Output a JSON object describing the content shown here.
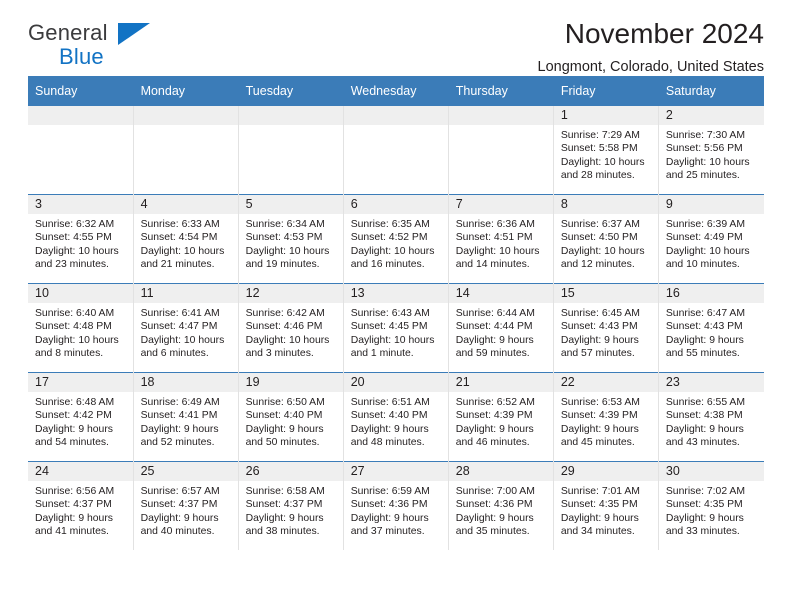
{
  "brand": {
    "name_top": "General",
    "name_bottom": "Blue",
    "triangle_icon": "brand-triangle-icon",
    "colors": {
      "text": "#3b3b3d",
      "accent": "#1273c4"
    }
  },
  "header": {
    "title": "November 2024",
    "location": "Longmont, Colorado, United States"
  },
  "calendar": {
    "header_color": "#3b7cb8",
    "daynum_band_color": "#efefef",
    "weekday_headers": [
      "Sunday",
      "Monday",
      "Tuesday",
      "Wednesday",
      "Thursday",
      "Friday",
      "Saturday"
    ],
    "weeks": [
      [
        {
          "day": ""
        },
        {
          "day": ""
        },
        {
          "day": ""
        },
        {
          "day": ""
        },
        {
          "day": ""
        },
        {
          "day": "1",
          "sunrise": "Sunrise: 7:29 AM",
          "sunset": "Sunset: 5:58 PM",
          "daylight": "Daylight: 10 hours and 28 minutes."
        },
        {
          "day": "2",
          "sunrise": "Sunrise: 7:30 AM",
          "sunset": "Sunset: 5:56 PM",
          "daylight": "Daylight: 10 hours and 25 minutes."
        }
      ],
      [
        {
          "day": "3",
          "sunrise": "Sunrise: 6:32 AM",
          "sunset": "Sunset: 4:55 PM",
          "daylight": "Daylight: 10 hours and 23 minutes."
        },
        {
          "day": "4",
          "sunrise": "Sunrise: 6:33 AM",
          "sunset": "Sunset: 4:54 PM",
          "daylight": "Daylight: 10 hours and 21 minutes."
        },
        {
          "day": "5",
          "sunrise": "Sunrise: 6:34 AM",
          "sunset": "Sunset: 4:53 PM",
          "daylight": "Daylight: 10 hours and 19 minutes."
        },
        {
          "day": "6",
          "sunrise": "Sunrise: 6:35 AM",
          "sunset": "Sunset: 4:52 PM",
          "daylight": "Daylight: 10 hours and 16 minutes."
        },
        {
          "day": "7",
          "sunrise": "Sunrise: 6:36 AM",
          "sunset": "Sunset: 4:51 PM",
          "daylight": "Daylight: 10 hours and 14 minutes."
        },
        {
          "day": "8",
          "sunrise": "Sunrise: 6:37 AM",
          "sunset": "Sunset: 4:50 PM",
          "daylight": "Daylight: 10 hours and 12 minutes."
        },
        {
          "day": "9",
          "sunrise": "Sunrise: 6:39 AM",
          "sunset": "Sunset: 4:49 PM",
          "daylight": "Daylight: 10 hours and 10 minutes."
        }
      ],
      [
        {
          "day": "10",
          "sunrise": "Sunrise: 6:40 AM",
          "sunset": "Sunset: 4:48 PM",
          "daylight": "Daylight: 10 hours and 8 minutes."
        },
        {
          "day": "11",
          "sunrise": "Sunrise: 6:41 AM",
          "sunset": "Sunset: 4:47 PM",
          "daylight": "Daylight: 10 hours and 6 minutes."
        },
        {
          "day": "12",
          "sunrise": "Sunrise: 6:42 AM",
          "sunset": "Sunset: 4:46 PM",
          "daylight": "Daylight: 10 hours and 3 minutes."
        },
        {
          "day": "13",
          "sunrise": "Sunrise: 6:43 AM",
          "sunset": "Sunset: 4:45 PM",
          "daylight": "Daylight: 10 hours and 1 minute."
        },
        {
          "day": "14",
          "sunrise": "Sunrise: 6:44 AM",
          "sunset": "Sunset: 4:44 PM",
          "daylight": "Daylight: 9 hours and 59 minutes."
        },
        {
          "day": "15",
          "sunrise": "Sunrise: 6:45 AM",
          "sunset": "Sunset: 4:43 PM",
          "daylight": "Daylight: 9 hours and 57 minutes."
        },
        {
          "day": "16",
          "sunrise": "Sunrise: 6:47 AM",
          "sunset": "Sunset: 4:43 PM",
          "daylight": "Daylight: 9 hours and 55 minutes."
        }
      ],
      [
        {
          "day": "17",
          "sunrise": "Sunrise: 6:48 AM",
          "sunset": "Sunset: 4:42 PM",
          "daylight": "Daylight: 9 hours and 54 minutes."
        },
        {
          "day": "18",
          "sunrise": "Sunrise: 6:49 AM",
          "sunset": "Sunset: 4:41 PM",
          "daylight": "Daylight: 9 hours and 52 minutes."
        },
        {
          "day": "19",
          "sunrise": "Sunrise: 6:50 AM",
          "sunset": "Sunset: 4:40 PM",
          "daylight": "Daylight: 9 hours and 50 minutes."
        },
        {
          "day": "20",
          "sunrise": "Sunrise: 6:51 AM",
          "sunset": "Sunset: 4:40 PM",
          "daylight": "Daylight: 9 hours and 48 minutes."
        },
        {
          "day": "21",
          "sunrise": "Sunrise: 6:52 AM",
          "sunset": "Sunset: 4:39 PM",
          "daylight": "Daylight: 9 hours and 46 minutes."
        },
        {
          "day": "22",
          "sunrise": "Sunrise: 6:53 AM",
          "sunset": "Sunset: 4:39 PM",
          "daylight": "Daylight: 9 hours and 45 minutes."
        },
        {
          "day": "23",
          "sunrise": "Sunrise: 6:55 AM",
          "sunset": "Sunset: 4:38 PM",
          "daylight": "Daylight: 9 hours and 43 minutes."
        }
      ],
      [
        {
          "day": "24",
          "sunrise": "Sunrise: 6:56 AM",
          "sunset": "Sunset: 4:37 PM",
          "daylight": "Daylight: 9 hours and 41 minutes."
        },
        {
          "day": "25",
          "sunrise": "Sunrise: 6:57 AM",
          "sunset": "Sunset: 4:37 PM",
          "daylight": "Daylight: 9 hours and 40 minutes."
        },
        {
          "day": "26",
          "sunrise": "Sunrise: 6:58 AM",
          "sunset": "Sunset: 4:37 PM",
          "daylight": "Daylight: 9 hours and 38 minutes."
        },
        {
          "day": "27",
          "sunrise": "Sunrise: 6:59 AM",
          "sunset": "Sunset: 4:36 PM",
          "daylight": "Daylight: 9 hours and 37 minutes."
        },
        {
          "day": "28",
          "sunrise": "Sunrise: 7:00 AM",
          "sunset": "Sunset: 4:36 PM",
          "daylight": "Daylight: 9 hours and 35 minutes."
        },
        {
          "day": "29",
          "sunrise": "Sunrise: 7:01 AM",
          "sunset": "Sunset: 4:35 PM",
          "daylight": "Daylight: 9 hours and 34 minutes."
        },
        {
          "day": "30",
          "sunrise": "Sunrise: 7:02 AM",
          "sunset": "Sunset: 4:35 PM",
          "daylight": "Daylight: 9 hours and 33 minutes."
        }
      ]
    ]
  }
}
